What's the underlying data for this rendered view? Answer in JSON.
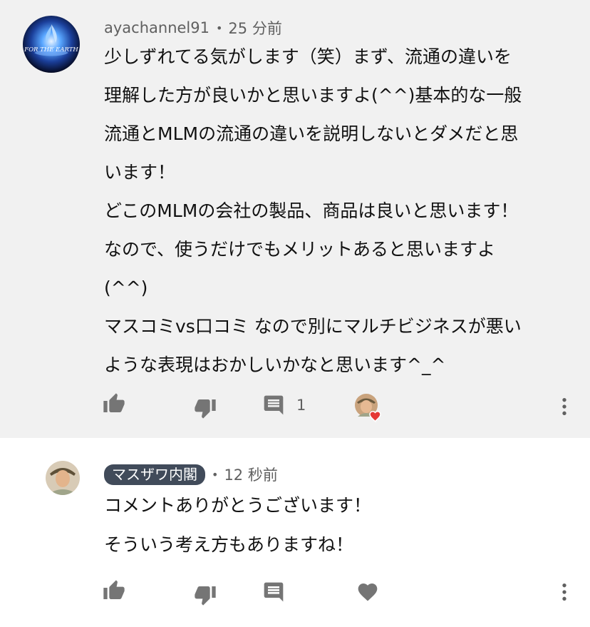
{
  "colors": {
    "thread_background": "#f1f1f1",
    "reply_background": "#ffffff",
    "text": "#111111",
    "meta_text": "#606060",
    "icon_gray": "#757575",
    "owner_badge": "#414b5a",
    "heart_red": "#e53935"
  },
  "comment": {
    "author": "ayachannel91",
    "separator": "•",
    "time": "25 分前",
    "lines": [
      "少しずれてる気がします（笑）まず、流通の違いを",
      "理解した方が良いかと思いますよ(^^)基本的な一般",
      "流通とMLMの流通の違いを説明しないとダメだと思",
      "います！",
      "どこのMLMの会社の製品、商品は良いと思います！",
      "なので、使うだけでもメリットあると思いますよ",
      "(^^)",
      "マスコミvs口コミ なので別にマルチビジネスが悪い",
      "ような表現はおかしいかなと思います^_^"
    ],
    "actions": {
      "like_icon": "thumb-up-icon",
      "dislike_icon": "thumb-down-icon",
      "reply_icon": "comment-icon",
      "reply_count": "1",
      "creator_heart": "creator-heart-icon",
      "menu_icon": "more-vertical-icon"
    }
  },
  "reply": {
    "author": "マスザワ内閣",
    "author_is_owner": true,
    "separator": "•",
    "time": "12 秒前",
    "lines": [
      "コメントありがとうございます！",
      "そういう考え方もありますね！"
    ],
    "actions": {
      "like_icon": "thumb-up-icon",
      "dislike_icon": "thumb-down-icon",
      "reply_icon": "comment-icon",
      "heart_icon": "heart-icon",
      "menu_icon": "more-vertical-icon"
    }
  }
}
